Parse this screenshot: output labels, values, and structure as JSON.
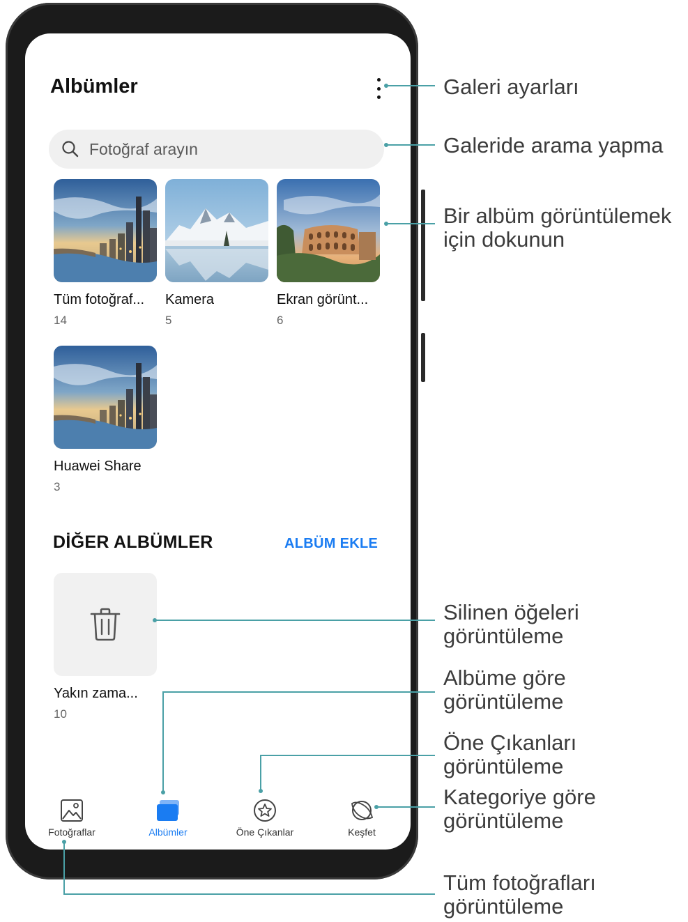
{
  "header": {
    "title": "Albümler"
  },
  "search": {
    "placeholder": "Fotoğraf arayın"
  },
  "albums": [
    {
      "name": "Tüm fotoğraf...",
      "count": "14"
    },
    {
      "name": "Kamera",
      "count": "5"
    },
    {
      "name": "Ekran görünt...",
      "count": "6"
    },
    {
      "name": "Huawei Share",
      "count": "3"
    }
  ],
  "other_albums": {
    "title": "DİĞER ALBÜMLER",
    "add_label": "ALBÜM EKLE",
    "items": [
      {
        "name": "Yakın zama...",
        "count": "10"
      }
    ]
  },
  "bottom_nav": [
    {
      "label": "Fotoğraflar",
      "icon": "image-icon",
      "active": false
    },
    {
      "label": "Albümler",
      "icon": "albums-icon",
      "active": true
    },
    {
      "label": "Öne Çıkanlar",
      "icon": "star-icon",
      "active": false
    },
    {
      "label": "Keşfet",
      "icon": "planet-icon",
      "active": false
    }
  ],
  "annotations": {
    "settings": "Galeri ayarları",
    "search": "Galeride arama yapma",
    "album_line1": "Bir albüm görüntülemek",
    "album_line2": "için dokunun",
    "deleted_line1": "Silinen öğeleri",
    "deleted_line2": "görüntüleme",
    "by_album_line1": "Albüme göre",
    "by_album_line2": "görüntüleme",
    "highlights_line1": "Öne Çıkanları",
    "highlights_line2": "görüntüleme",
    "category_line1": "Kategoriye göre",
    "category_line2": "görüntüleme",
    "all_line1": "Tüm fotoğrafları",
    "all_line2": "görüntüleme"
  },
  "colors": {
    "accent": "#1a7cf2",
    "annotation_line": "#4aa0a6",
    "phone_body": "#1b1b1b"
  }
}
